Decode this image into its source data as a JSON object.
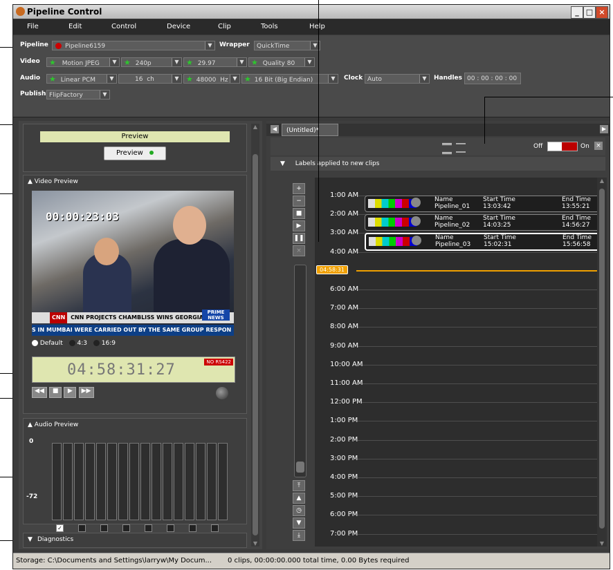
{
  "title": "Pipeline Control",
  "menu": [
    "File",
    "Edit",
    "Control",
    "Device",
    "Clip",
    "Tools",
    "Help"
  ],
  "settings": {
    "pipeline_label": "Pipeline",
    "pipeline_value": "Pipeline6159",
    "wrapper_label": "Wrapper",
    "wrapper_value": "QuickTime",
    "video_label": "Video",
    "video_codec": "Motion JPEG",
    "video_size": "240p",
    "video_rate": "29.97",
    "video_quality": "Quality 80",
    "audio_label": "Audio",
    "audio_codec": "Linear PCM",
    "audio_channels": "16",
    "audio_ch_unit": "ch",
    "audio_rate": "48000",
    "audio_rate_unit": "Hz",
    "audio_bits": "16 Bit (Big Endian)",
    "clock_label": "Clock",
    "clock_value": "Auto",
    "handles_label": "Handles",
    "handles_value": "00 : 00 : 00 : 00",
    "publish_label": "Publish",
    "publish_value": "FlipFactory"
  },
  "left": {
    "preview_bar": "Preview",
    "preview_button": "Preview",
    "video_preview_header": "Video Preview",
    "video_burnin": "00:00:23:03",
    "video_ticker_brand": "CNN",
    "video_ticker": "CNN PROJECTS CHAMBLISS WINS GEORGIA",
    "video_crawl": "S IN MUMBAI WERE CARRIED OUT BY THE SAME GROUP RESPON",
    "video_prime": "PRIME NEWS",
    "aspect_default": "Default",
    "aspect_43": "4:3",
    "aspect_169": "16:9",
    "timecode": "04:58:31:27",
    "no_rs422": "NO RS422",
    "audio_preview_header": "Audio Preview",
    "meter_top": "0",
    "meter_bottom": "-72",
    "diagnostics": "Diagnostics"
  },
  "right": {
    "tab_title": "(Untitled)*",
    "off_label": "Off",
    "on_label": "On",
    "labels_header": "Labels applied to new clips",
    "playhead": "04:58:31",
    "hours": [
      "1:00 AM",
      "2:00 AM",
      "3:00 AM",
      "4:00 AM",
      "5:00 AM",
      "6:00 AM",
      "7:00 AM",
      "8:00 AM",
      "9:00 AM",
      "10:00 AM",
      "11:00 AM",
      "12:00 PM",
      "1:00 PM",
      "2:00 PM",
      "3:00 PM",
      "4:00 PM",
      "5:00 PM",
      "6:00 PM",
      "7:00 PM"
    ],
    "clip_header": {
      "name": "Name",
      "start": "Start Time",
      "end": "End Time"
    },
    "clips": [
      {
        "name": "Pipeline_01",
        "start": "13:03:42",
        "end": "13:55:21"
      },
      {
        "name": "Pipeline_02",
        "start": "14:03:25",
        "end": "14:56:27"
      },
      {
        "name": "Pipeline_03",
        "start": "15:02:31",
        "end": "15:56:58"
      }
    ]
  },
  "status": {
    "storage": "Storage: C:\\Documents and Settings\\larryw\\My Docum...",
    "summary": "0 clips, 00:00:00.000 total time, 0.00 Bytes required"
  },
  "colors": {
    "accent": "#f0a000",
    "panel": "#3e3e3e",
    "preview_bar": "#dfe6b0"
  }
}
